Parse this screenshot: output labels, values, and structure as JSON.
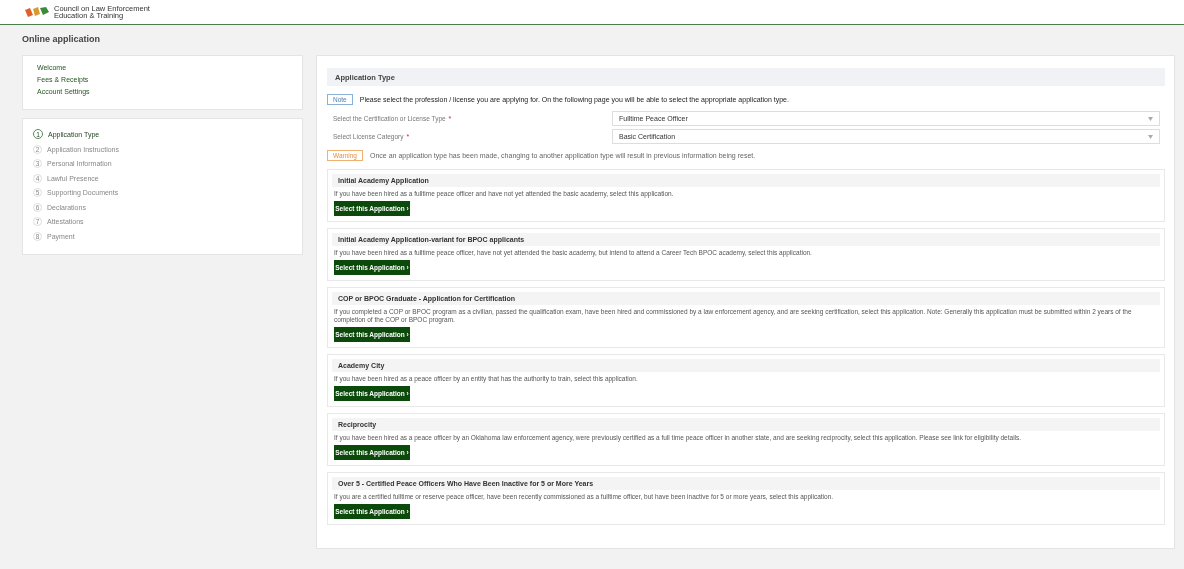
{
  "header": {
    "org_name": [
      "Council on Law Enforcement",
      "Education & Training"
    ]
  },
  "page_title": "Online application",
  "nav_links": [
    "Welcome",
    "Fees & Receipts",
    "Account Settings"
  ],
  "steps": [
    {
      "number": "1",
      "label": "Application Type",
      "selected": true
    },
    {
      "number": "2",
      "label": "Application Instructions",
      "selected": false
    },
    {
      "number": "3",
      "label": "Personal Information",
      "selected": false
    },
    {
      "number": "4",
      "label": "Lawful Presence",
      "selected": false
    },
    {
      "number": "5",
      "label": "Supporting Documents",
      "selected": false
    },
    {
      "number": "6",
      "label": "Declarations",
      "selected": false
    },
    {
      "number": "7",
      "label": "Attestations",
      "selected": false
    },
    {
      "number": "8",
      "label": "Payment",
      "selected": false
    }
  ],
  "section_title": "Application Type",
  "note": {
    "badge": "Note",
    "text": "Please select the profession / license you are applying for. On the following page you will be able to select the appropriate application type."
  },
  "fields": [
    {
      "label": "Select the Certification or License Type",
      "required_mark": "*",
      "value": "Fulltime Peace Officer"
    },
    {
      "label": "Select License Category",
      "required_mark": "*",
      "value": "Basic Certification"
    }
  ],
  "warning": {
    "badge": "Warning",
    "text": "Once an application type has been made, changing to another application type will result in previous information being reset."
  },
  "applications": [
    {
      "title": "Initial Academy Application",
      "description": "If you have been hired as a fulltime peace officer and have not yet attended the basic academy, select this application.",
      "button": "Select this Application ›"
    },
    {
      "title": "Initial Academy Application-variant for BPOC applicants",
      "description": "If you have been hired as a fulltime peace officer, have not yet attended the basic academy, but intend to attend a Career Tech BPOC academy, select this application.",
      "button": "Select this Application ›"
    },
    {
      "title": "COP or BPOC Graduate - Application for Certification",
      "description": "If you completed a COP or BPOC program as a civilian, passed the qualification exam, have been hired and commissioned by a law enforcement agency, and are seeking certification, select this application. Note: Generally this application must be submitted within 2 years of the completion of the COP or BPOC program.",
      "button": "Select this Application ›"
    },
    {
      "title": "Academy City",
      "description": "If you have been hired as a peace officer by an entity that has the authority to train, select this application.",
      "button": "Select this Application ›"
    },
    {
      "title": "Reciprocity",
      "description": "If you have been hired as a peace officer by an Oklahoma law enforcement agency, were previously certified as a full time peace officer in another state, and are seeking reciprocity, select this application. Please see link for eligibility details.",
      "button": "Select this Application ›"
    },
    {
      "title": "Over 5 - Certified Peace Officers Who Have Been Inactive for 5 or More Years",
      "description": "If you are a certified fulltime or reserve peace officer, have been recently commissioned as a fulltime officer, but have been inactive for 5 or more years, select this application.",
      "button": "Select this Application ›"
    }
  ]
}
